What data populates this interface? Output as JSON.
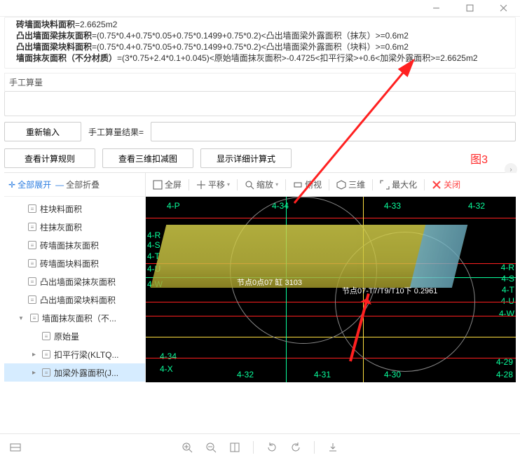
{
  "titlebar": {
    "minimize": "–",
    "maximize": "□",
    "close": "✕"
  },
  "formulas": {
    "line1_label": "砖墙面块料面积",
    "line1_val": "=2.6625m2",
    "line2_label": "凸出墙面梁抹灰面积",
    "line2_val": "=(0.75*0.4+0.75*0.05+0.75*0.1499+0.75*0.2)<凸出墙面梁外露面积（抹灰）>=0.6m2",
    "line3_label": "凸出墙面梁块料面积",
    "line3_val": "=(0.75*0.4+0.75*0.05+0.75*0.1499+0.75*0.2)<凸出墙面梁外露面积（块料）>=0.6m2",
    "line4_label": "墙面抹灰面积（不分材质）",
    "line4_val": "=(3*0.75+2.4*0.1+0.045)<原始墙面抹灰面积>-0.4725<扣平行梁>+0.6<加梁外露面积>=2.6625m2"
  },
  "manual": {
    "label": "手工算量"
  },
  "buttons": {
    "reinput": "重新输入",
    "result_label": "手工算量结果=",
    "rule": "查看计算规则",
    "deduct": "查看三维扣减图",
    "detail": "显示详细计算式"
  },
  "figLabel": "图3",
  "treeToolbar": {
    "expand": "全部展开",
    "collapse": "全部折叠"
  },
  "tree": {
    "items": [
      {
        "label": "柱块料面积"
      },
      {
        "label": "柱抹灰面积"
      },
      {
        "label": "砖墙面抹灰面积"
      },
      {
        "label": "砖墙面块料面积"
      },
      {
        "label": "凸出墙面梁抹灰面积"
      },
      {
        "label": "凸出墙面梁块料面积"
      },
      {
        "label": "墙面抹灰面积（不..."
      }
    ],
    "children": [
      {
        "label": "原始量"
      },
      {
        "label": "扣平行梁(KLTQ..."
      },
      {
        "label": "加梁外露面积(J..."
      }
    ]
  },
  "viewerTools": {
    "fullscreen": "全屏",
    "pan": "平移",
    "zoom": "缩放",
    "top": "俯视",
    "three": "三维",
    "max": "最大化",
    "close": "关闭"
  },
  "canvas": {
    "cols": [
      "4-P",
      "4-34",
      "4-33",
      "4-32"
    ],
    "colsBottom": [
      "4-34",
      "4-32",
      "4-31",
      "4-30",
      "4-29",
      "4-28"
    ],
    "colsX": "4-X",
    "rows": [
      "4-R",
      "4-S",
      "4-T",
      "4-U",
      "4-W"
    ],
    "rowsRight": [
      "4-R",
      "4-S",
      "4-T",
      "4-U",
      "4-W"
    ],
    "node1": "节点0点07 缸 3103",
    "node2": "节点07-T7/T9/T10下 0.2961"
  }
}
